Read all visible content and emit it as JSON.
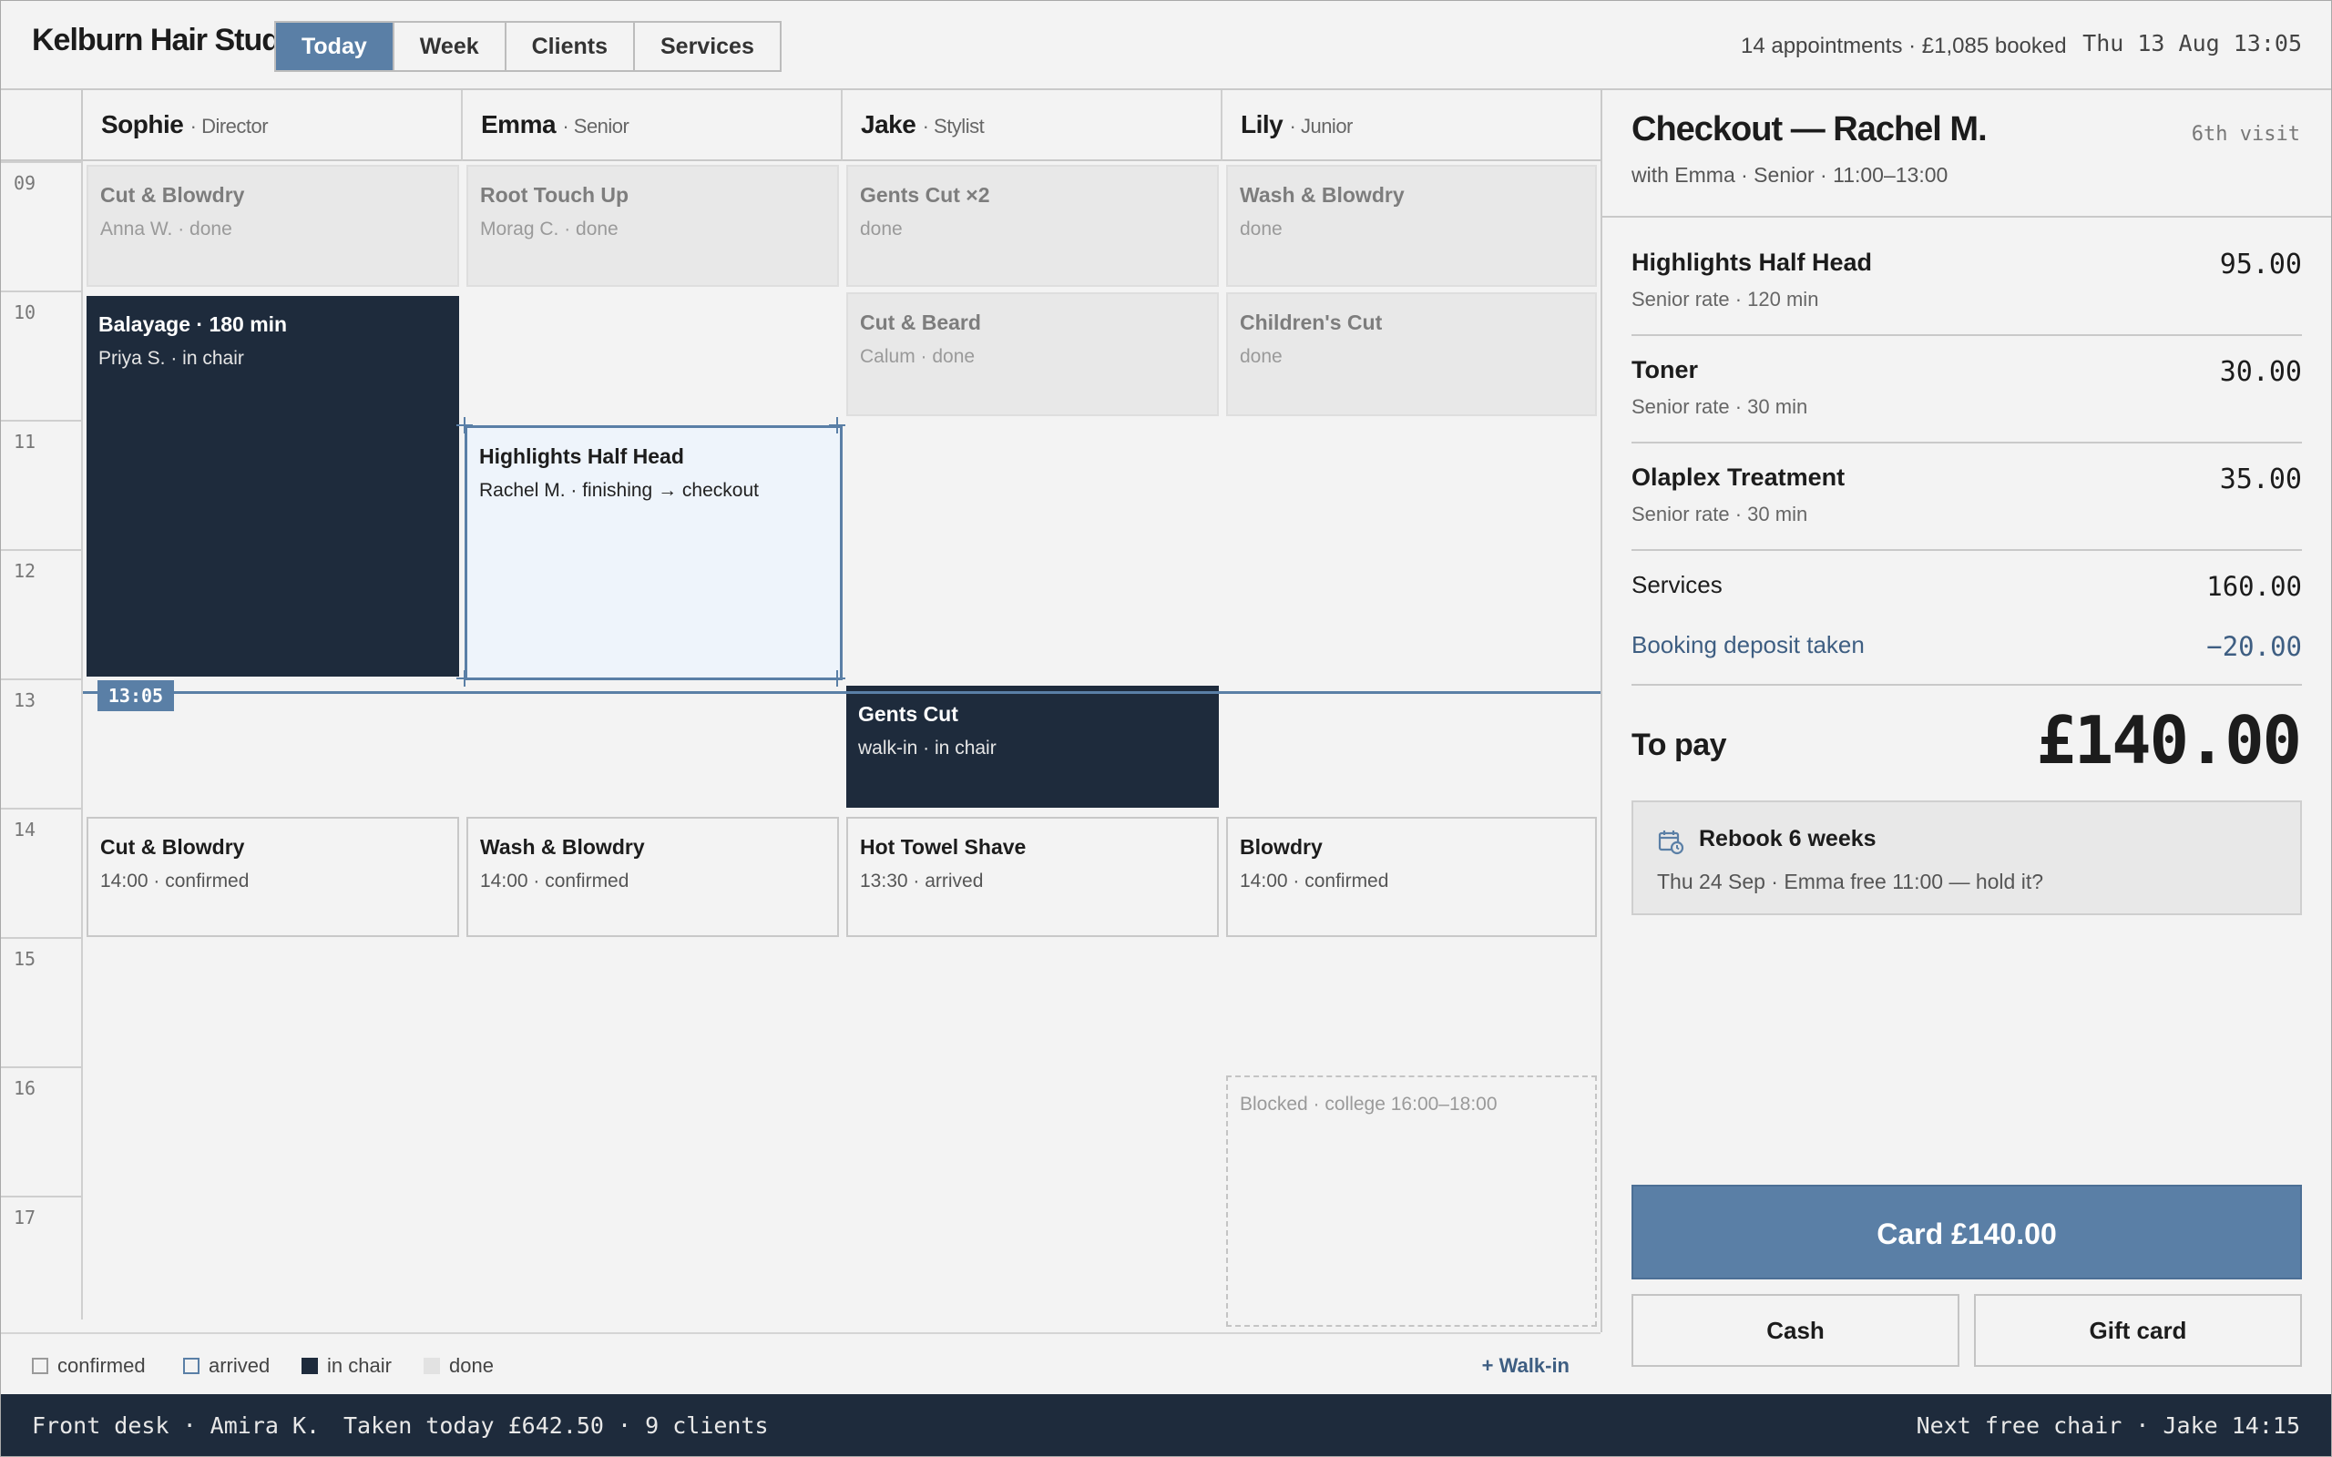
{
  "app": {
    "brand": "Kelburn Hair Studio",
    "nav": [
      "Today",
      "Week",
      "Clients",
      "Services"
    ],
    "active_nav": "Today",
    "summary": "14 appointments · £1,085 booked",
    "clock": "Thu 13 Aug 13:05"
  },
  "schedule": {
    "stylists": [
      {
        "name": "Sophie",
        "role": "· Director"
      },
      {
        "name": "Emma",
        "role": "· Senior"
      },
      {
        "name": "Jake",
        "role": "· Stylist"
      },
      {
        "name": "Lily",
        "role": "· Junior"
      }
    ],
    "hours": [
      "09",
      "10",
      "11",
      "12",
      "13",
      "14",
      "15",
      "16",
      "17"
    ],
    "now_label": "13:05",
    "appointments": {
      "sophie_9": {
        "title": "Cut & Blowdry",
        "sub": "Anna W. · done"
      },
      "emma_9": {
        "title": "Root Touch Up",
        "sub": "Morag C. · done"
      },
      "jake_9": {
        "title": "Gents Cut ×2",
        "sub": "done"
      },
      "lily_9": {
        "title": "Wash & Blowdry",
        "sub": "done"
      },
      "sophie_10": {
        "title": "Balayage · 180 min",
        "sub": "Priya S. · in chair"
      },
      "jake_10": {
        "title": "Cut & Beard",
        "sub": "Calum · done"
      },
      "lily_10": {
        "title": "Children's Cut",
        "sub": "done"
      },
      "emma_11": {
        "title": "Highlights Half Head",
        "sub": "Rachel M. · finishing → checkout"
      },
      "jake_13": {
        "title": "Gents Cut",
        "sub": "walk-in · in chair"
      },
      "sophie_14": {
        "title": "Cut & Blowdry",
        "sub": "14:00 · confirmed"
      },
      "emma_14": {
        "title": "Wash & Blowdry",
        "sub": "14:00 · confirmed"
      },
      "jake_14": {
        "title": "Hot Towel Shave",
        "sub": "13:30 · arrived"
      },
      "lily_14": {
        "title": "Blowdry",
        "sub": "14:00 · confirmed"
      },
      "lily_16": {
        "sub": "Blocked · college 16:00–18:00"
      }
    },
    "legend": [
      "confirmed",
      "arrived",
      "in chair",
      "done"
    ],
    "walkin_label": "+ Walk-in"
  },
  "checkout": {
    "title": "Checkout — Rachel M.",
    "visit": "6th visit",
    "subtitle": "with Emma · Senior · 11:00–13:00",
    "items": [
      {
        "name": "Highlights Half Head",
        "rate": "Senior rate · 120 min",
        "amount": "95.00"
      },
      {
        "name": "Toner",
        "rate": "Senior rate · 30 min",
        "amount": "30.00"
      },
      {
        "name": "Olaplex Treatment",
        "rate": "Senior rate · 30 min",
        "amount": "35.00"
      }
    ],
    "services_label": "Services",
    "services_total": "160.00",
    "deposit_label": "Booking deposit taken",
    "deposit_amount": "−20.00",
    "topay_label": "To pay",
    "topay_amount": "£140.00",
    "rebook_title": "Rebook 6 weeks",
    "rebook_sub": "Thu 24 Sep · Emma free 11:00 — hold it?",
    "card_button": "Card £140.00",
    "cash_button": "Cash",
    "giftcard_button": "Gift card"
  },
  "status": {
    "left": "Front desk · Amira K.",
    "middle": "Taken today £642.50 · 9 clients",
    "right": "Next free chair · Jake 14:15"
  },
  "colors": {
    "accent": "#5a7fa6",
    "in_chair": "#1e2b3c",
    "done": "#e8e8e8",
    "selected": "#eef4fb"
  }
}
